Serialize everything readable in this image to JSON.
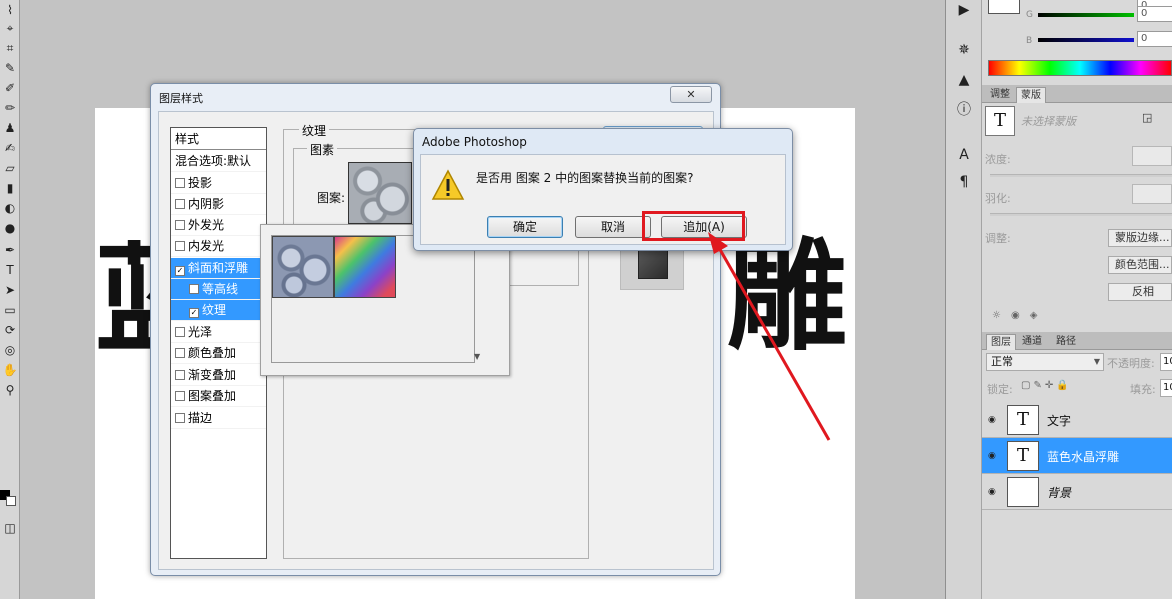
{
  "layer_style_dialog": {
    "title": "图层样式",
    "styles_header": "样式",
    "blend_options": "混合选项:默认",
    "items": [
      {
        "label": "投影",
        "checked": false
      },
      {
        "label": "内阴影",
        "checked": false
      },
      {
        "label": "外发光",
        "checked": false
      },
      {
        "label": "内发光",
        "checked": false
      },
      {
        "label": "斜面和浮雕",
        "checked": true
      },
      {
        "label": "等高线",
        "checked": false
      },
      {
        "label": "纹理",
        "checked": true
      },
      {
        "label": "光泽",
        "checked": false
      },
      {
        "label": "颜色叠加",
        "checked": false
      },
      {
        "label": "渐变叠加",
        "checked": false
      },
      {
        "label": "图案叠加",
        "checked": false
      },
      {
        "label": "描边",
        "checked": false
      }
    ],
    "texture_section": "纹理",
    "pattern_group": "图素",
    "pattern_label": "图案:"
  },
  "alert": {
    "title": "Adobe Photoshop",
    "message": "是否用 图案 2 中的图案替换当前的图案?",
    "ok": "确定",
    "cancel": "取消",
    "append": "追加(A)"
  },
  "canvas": {
    "char_left": "蓝",
    "char_right": "雕"
  },
  "color_panel": {
    "g_label": "G",
    "b_label": "B",
    "g_value": "0",
    "b_value": "0",
    "top_value": "0"
  },
  "adjust_panel": {
    "tab_adjust": "调整",
    "tab_mask": "蒙版",
    "no_mask": "未选择蒙版",
    "density": "浓度:",
    "feather": "羽化:",
    "refine": "调整:",
    "mask_edge": "蒙版边缘...",
    "color_range": "颜色范围...",
    "invert": "反相"
  },
  "layers_panel": {
    "tab_layers": "图层",
    "tab_channels": "通道",
    "tab_paths": "路径",
    "blend_mode": "正常",
    "opacity_label": "不透明度:",
    "opacity_value": "10",
    "lock_label": "锁定:",
    "fill_label": "填充:",
    "fill_value": "10",
    "layers": [
      {
        "name": "文字",
        "selected": false
      },
      {
        "name": "蓝色水晶浮雕",
        "selected": true
      },
      {
        "name": "背景",
        "selected": false
      }
    ]
  },
  "colors": {
    "highlight": "#3399ff",
    "annotation_red": "#e0181f"
  }
}
